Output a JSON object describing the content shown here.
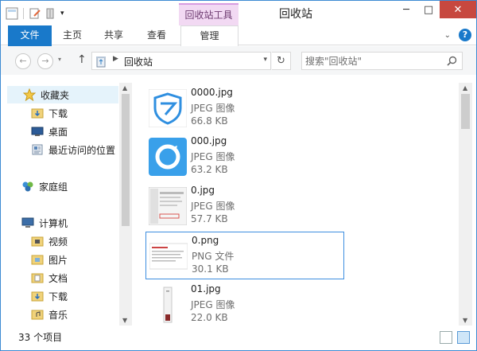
{
  "window": {
    "title": "回收站",
    "context_tab": "回收站工具",
    "buttons": {
      "minimize": "─",
      "maximize": "□",
      "close": "✕"
    }
  },
  "quick_access": {
    "icons": [
      "properties-icon",
      "new-folder-icon",
      "dropdown-icon"
    ]
  },
  "ribbon": {
    "tabs": [
      "文件",
      "主页",
      "共享",
      "查看",
      "管理"
    ],
    "active_tab": "管理",
    "help_label": "?"
  },
  "address_bar": {
    "path": "回收站",
    "search_placeholder": "搜索\"回收站\""
  },
  "nav_pane": {
    "favorites": {
      "label": "收藏夹",
      "items": [
        "下载",
        "桌面",
        "最近访问的位置"
      ]
    },
    "homegroup": "家庭组",
    "computer": {
      "label": "计算机",
      "items": [
        "视频",
        "图片",
        "文档",
        "下载",
        "音乐"
      ]
    }
  },
  "files": [
    {
      "name": "0000.jpg",
      "type": "JPEG 图像",
      "size": "66.8 KB",
      "thumb": "shield-app-icon",
      "selected": false
    },
    {
      "name": "000.jpg",
      "type": "JPEG 图像",
      "size": "63.2 KB",
      "thumb": "refresh-app-icon",
      "selected": false
    },
    {
      "name": "0.jpg",
      "type": "JPEG 图像",
      "size": "57.7 KB",
      "thumb": "screenshot-thumbnail",
      "selected": false
    },
    {
      "name": "0.png",
      "type": "PNG 文件",
      "size": "30.1 KB",
      "thumb": "webpage-thumbnail",
      "selected": true
    },
    {
      "name": "01.jpg",
      "type": "JPEG 图像",
      "size": "22.0 KB",
      "thumb": "device-thumbnail",
      "selected": false
    }
  ],
  "status_bar": {
    "item_count": "33 个项目"
  },
  "colors": {
    "accent": "#1979ca",
    "context_tab": "#f2d9f3",
    "close": "#c7483f",
    "selection": "#3d8ee0"
  }
}
